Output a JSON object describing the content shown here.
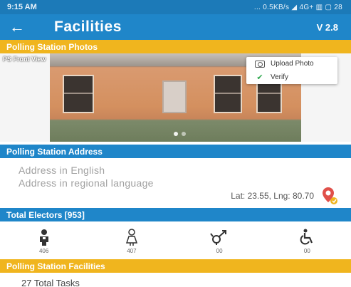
{
  "status_bar": {
    "time": "9:15 AM",
    "right": "... 0.5KB/s ◢ 4G+ ▥ ▢ 28"
  },
  "app_bar": {
    "title": "Facilities",
    "version": "V 2.8"
  },
  "sections": {
    "photos": "Polling Station Photos",
    "address": "Polling Station Address",
    "electors": "Total Electors [953]",
    "facilities": "Polling Station Facilities"
  },
  "photo": {
    "caption": "PS Front View",
    "menu": {
      "upload": "Upload Photo",
      "verify": "Verify"
    }
  },
  "address": {
    "english": "Address in English",
    "regional": "Address in regional language",
    "latlng": "Lat: 23.55, Lng: 80.70"
  },
  "electors": [
    {
      "icon": "male-voter-icon",
      "count": "406"
    },
    {
      "icon": "female-voter-icon",
      "count": "407"
    },
    {
      "icon": "third-gender-icon",
      "count": "00"
    },
    {
      "icon": "disabled-voter-icon",
      "count": "00"
    }
  ],
  "tasks": {
    "label": "27 Total Tasks"
  },
  "colors": {
    "primary": "#1f86c9",
    "status": "#1c7ab8",
    "accent": "#f0b51e",
    "verify": "#2fa84f",
    "pin": "#e0504a"
  }
}
